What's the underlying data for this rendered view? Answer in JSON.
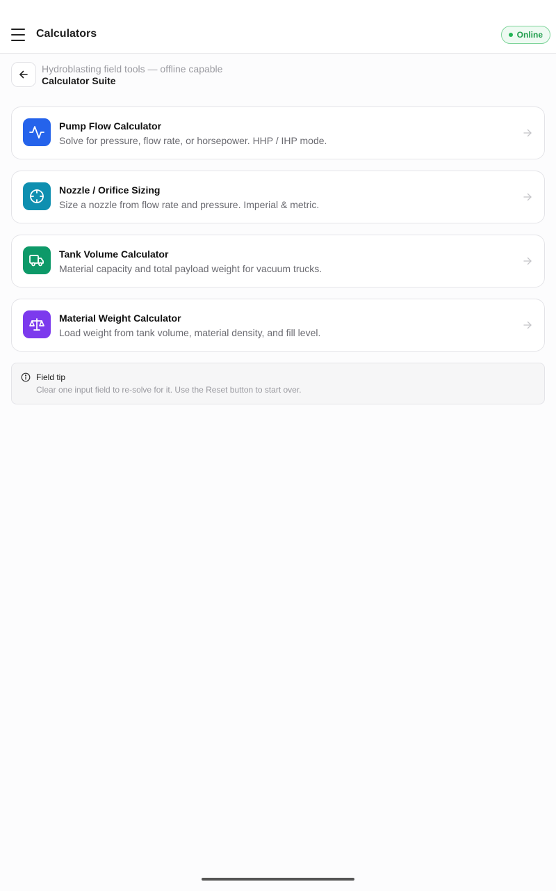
{
  "header": {
    "title": "Calculators",
    "status": "Online",
    "status_color": "#22b455",
    "menu_icon": "hamburger-menu-icon"
  },
  "breadcrumb": {
    "back_icon": "arrow-left-icon",
    "subtitle": "Hydroblasting field tools — offline capable",
    "title": "Calculator Suite"
  },
  "calculators": [
    {
      "title": "Pump Flow Calculator",
      "description": "Solve for pressure, flow rate, or horsepower. HHP / IHP mode.",
      "icon": "activity-pulse-icon",
      "color": "#2563eb"
    },
    {
      "title": "Nozzle / Orifice Sizing",
      "description": "Size a nozzle from flow rate and pressure. Imperial & metric.",
      "icon": "crosshair-icon",
      "color": "#0e8fb0"
    },
    {
      "title": "Tank Volume Calculator",
      "description": "Material capacity and total payload weight for vacuum trucks.",
      "icon": "truck-icon",
      "color": "#0d9968"
    },
    {
      "title": "Material Weight Calculator",
      "description": "Load weight from tank volume, material density, and fill level.",
      "icon": "scale-icon",
      "color": "#7c3aed"
    }
  ],
  "tip": {
    "icon": "info-icon",
    "title": "Field tip",
    "text": "Clear one input field to re-solve for it. Use the Reset button to start over."
  }
}
